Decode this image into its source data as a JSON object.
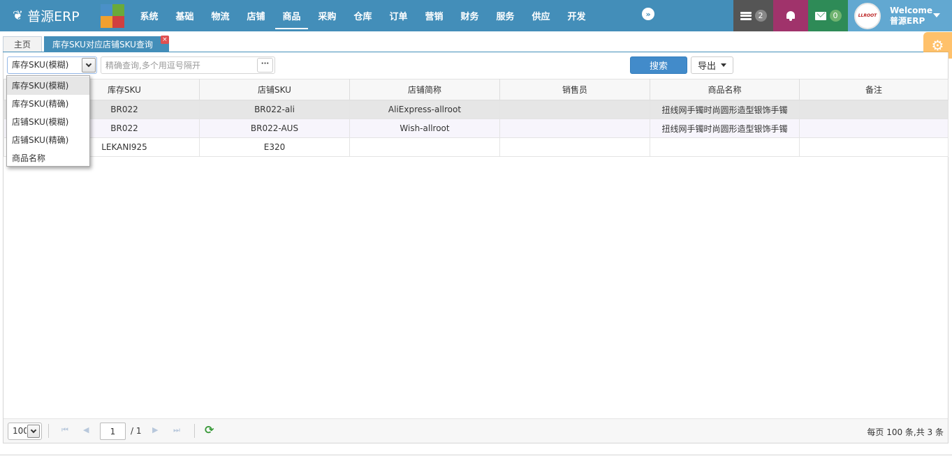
{
  "app": {
    "title": "普源ERP"
  },
  "brand_colors": {
    "nav_bg": "#438eb9",
    "tasks_bg": "#555555",
    "bell_bg": "#a0336b",
    "mail_bg": "#2e8b57",
    "user_bg": "#62a8d1",
    "tile_colors": [
      "#4a90c8",
      "#6aaa3a",
      "#f0a030",
      "#d04040"
    ]
  },
  "nav": {
    "items": [
      "系统",
      "基础",
      "物流",
      "店铺",
      "商品",
      "采购",
      "仓库",
      "订单",
      "营销",
      "财务",
      "服务",
      "供应",
      "开发"
    ],
    "active_index": 4,
    "expand_icon": "double-chevron-right-icon"
  },
  "tray": {
    "tasks_count": "2",
    "mail_count": "0",
    "user": {
      "avatar_text": "LLROOT",
      "welcome": "Welcome",
      "name": "普源ERP"
    }
  },
  "tabs": [
    {
      "label": "主页"
    },
    {
      "label": "库存SKU对应店铺SKU查询",
      "close": "×"
    }
  ],
  "toolbar": {
    "search_field": {
      "selected": "库存SKU(模糊)",
      "options": [
        "库存SKU(模糊)",
        "库存SKU(精确)",
        "店铺SKU(模糊)",
        "店铺SKU(精确)",
        "商品名称"
      ]
    },
    "query_placeholder": "精确查询,多个用逗号隔开",
    "more_label": "···",
    "search_label": "搜索",
    "export_label": "导出"
  },
  "grid": {
    "columns": [
      "",
      "库存SKU",
      "店铺SKU",
      "店铺简称",
      "销售员",
      "商品名称",
      "备注"
    ],
    "rows": [
      [
        "",
        "BR022",
        "BR022-ali",
        "AliExpress-allroot",
        "",
        "扭线网手镯时尚圆形造型银饰手镯",
        ""
      ],
      [
        "",
        "BR022",
        "BR022-AUS",
        "Wish-allroot",
        "",
        "扭线网手镯时尚圆形造型银饰手镯",
        ""
      ],
      [
        "",
        "LEKANI925",
        "E320",
        "",
        "",
        "",
        ""
      ]
    ]
  },
  "pager": {
    "page_size": "100",
    "current_page": "1",
    "total_pages": "/ 1",
    "info": "每页 100 条,共 3 条"
  }
}
